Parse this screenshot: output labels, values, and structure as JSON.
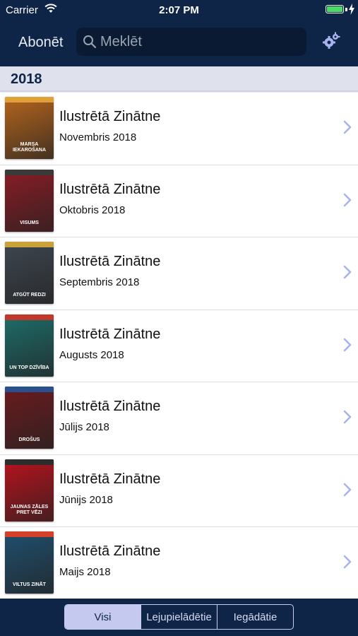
{
  "status_bar": {
    "carrier": "Carrier",
    "time": "2:07 PM",
    "battery_level": 1.0
  },
  "nav": {
    "subscribe_label": "Abonēt",
    "search_placeholder": "Meklēt",
    "settings_icon": "gear-icon"
  },
  "section": {
    "title": "2018"
  },
  "issues": [
    {
      "title": "Ilustrētā Zinātne",
      "date": "Novembris 2018",
      "cover_color": "#b5651d",
      "band_color": "#e0a03a",
      "headline": "MARSA IEKAROŠANA"
    },
    {
      "title": "Ilustrētā Zinātne",
      "date": "Oktobris 2018",
      "cover_color": "#8a1c24",
      "band_color": "#3a3a3a",
      "headline": "VISUMS"
    },
    {
      "title": "Ilustrētā Zinātne",
      "date": "Septembris 2018",
      "cover_color": "#3e4650",
      "band_color": "#c9a23a",
      "headline": "ATGŪT REDZI"
    },
    {
      "title": "Ilustrētā Zinātne",
      "date": "Augusts 2018",
      "cover_color": "#1d6d6a",
      "band_color": "#c0392b",
      "headline": "UN TOP DZĪVĪBA"
    },
    {
      "title": "Ilustrētā Zinātne",
      "date": "Jūlijs 2018",
      "cover_color": "#6b1b1e",
      "band_color": "#2a4f8f",
      "headline": "DROŠUS"
    },
    {
      "title": "Ilustrētā Zinātne",
      "date": "Jūnijs 2018",
      "cover_color": "#b8121c",
      "band_color": "#2d2d2d",
      "headline": "JAUNAS ZĀLES PRET VĒZI"
    },
    {
      "title": "Ilustrētā Zinātne",
      "date": "Maijs 2018",
      "cover_color": "#1f4f6e",
      "band_color": "#d4402a",
      "headline": "VILTUS ZINĀT"
    }
  ],
  "segments": [
    {
      "label": "Visi",
      "active": true
    },
    {
      "label": "Lejupielādētie",
      "active": false
    },
    {
      "label": "Iegādātie",
      "active": false
    }
  ]
}
